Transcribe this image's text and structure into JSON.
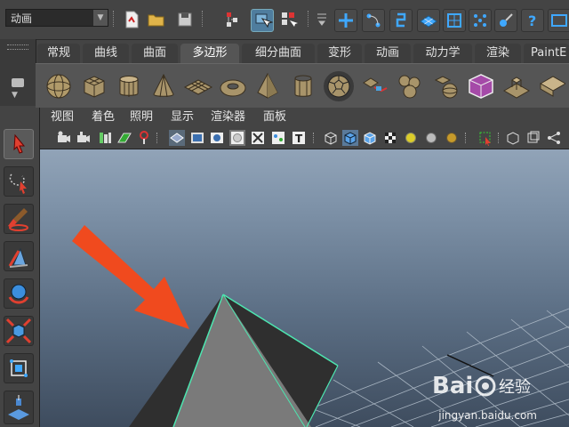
{
  "status_line": {
    "mode_select": "动画"
  },
  "shelf": {
    "tabs": [
      "常规",
      "曲线",
      "曲面",
      "多边形",
      "细分曲面",
      "变形",
      "动画",
      "动力学",
      "渲染",
      "PaintE"
    ],
    "active_tab": "多边形",
    "icons": [
      "poly-sphere-icon",
      "poly-cube-icon",
      "poly-cylinder-icon",
      "poly-cone-icon",
      "poly-plane-icon",
      "poly-torus-icon",
      "poly-pyramid-icon",
      "poly-pipe-icon",
      "poly-soccer-ball-icon",
      "poly-helix-icon",
      "combine-icon",
      "separate-icon",
      "smooth-mesh-icon",
      "extrude-icon",
      "bevel-icon"
    ]
  },
  "viewport": {
    "menu": [
      "视图",
      "着色",
      "照明",
      "显示",
      "渲染器",
      "面板"
    ]
  },
  "colors": {
    "ui_bg": "#444444",
    "viewport_top": "#9fb0c3",
    "viewport_bottom": "#3e4c5e",
    "selection_wire": "#4de6b0",
    "arrow": "#f04a1e",
    "pyramid_lit": "#7a7a7a",
    "pyramid_dark": "#2e2e2e"
  },
  "watermark": {
    "logo_text": "Bai 经验",
    "sub": "jingyan.baidu.com"
  }
}
